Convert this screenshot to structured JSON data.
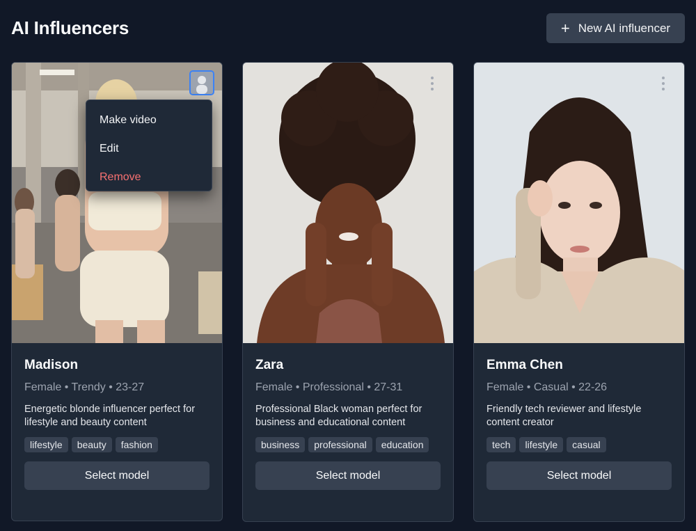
{
  "header": {
    "title": "AI Influencers",
    "new_button_label": "New AI influencer"
  },
  "menu": {
    "items": [
      "Make video",
      "Edit",
      "Remove"
    ]
  },
  "cards": [
    {
      "name": "Madison",
      "meta": "Female • Trendy • 23-27",
      "description": "Energetic blonde influencer perfect for lifestyle and beauty content",
      "tags": [
        "lifestyle",
        "beauty",
        "fashion"
      ],
      "button_label": "Select model"
    },
    {
      "name": "Zara",
      "meta": "Female • Professional • 27-31",
      "description": "Professional Black woman perfect for business and educational content",
      "tags": [
        "business",
        "professional",
        "education"
      ],
      "button_label": "Select model"
    },
    {
      "name": "Emma Chen",
      "meta": "Female • Casual • 22-26",
      "description": "Friendly tech reviewer and lifestyle content creator",
      "tags": [
        "tech",
        "lifestyle",
        "casual"
      ],
      "button_label": "Select model"
    }
  ],
  "icons": {
    "new_button": "plus-icon",
    "card_menu": "kebab-icon"
  },
  "colors": {
    "background": "#111827",
    "card": "#1f2937",
    "button": "#374151",
    "danger": "#f87171",
    "focus": "#3b82f6"
  }
}
